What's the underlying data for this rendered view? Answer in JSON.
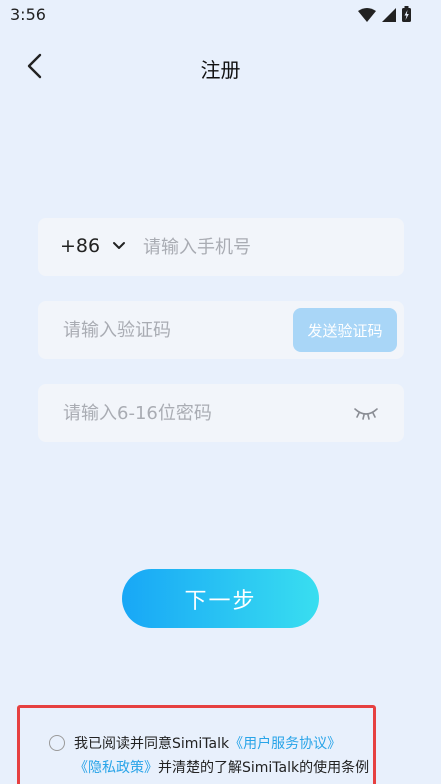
{
  "status_bar": {
    "time": "3:56",
    "icons": [
      "wifi-icon",
      "cell-signal-icon",
      "battery-icon"
    ]
  },
  "nav": {
    "title": "注册",
    "back_icon": "chevron-left-icon"
  },
  "phone_field": {
    "country_code": "+86",
    "placeholder": "请输入手机号"
  },
  "code_field": {
    "placeholder": "请输入验证码",
    "send_button_label": "发送验证码"
  },
  "password_field": {
    "placeholder": "请输入6-16位密码",
    "toggle_icon": "eye-closed-icon"
  },
  "next_button_label": "下一步",
  "agreement": {
    "prefix": "我已阅读并同意SimiTalk",
    "user_agreement_link": "《用户服务协议》",
    "privacy_link": "《隐私政策》",
    "suffix": "并清楚的了解SimiTalk的使用条例"
  },
  "colors": {
    "background": "#e8f0fc",
    "field_bg": "#f2f5fa",
    "send_button": "#a9d6f7",
    "primary_gradient_start": "#18a7f6",
    "primary_gradient_end": "#39def0",
    "link": "#29a4e8",
    "highlight_border": "#e64040"
  }
}
